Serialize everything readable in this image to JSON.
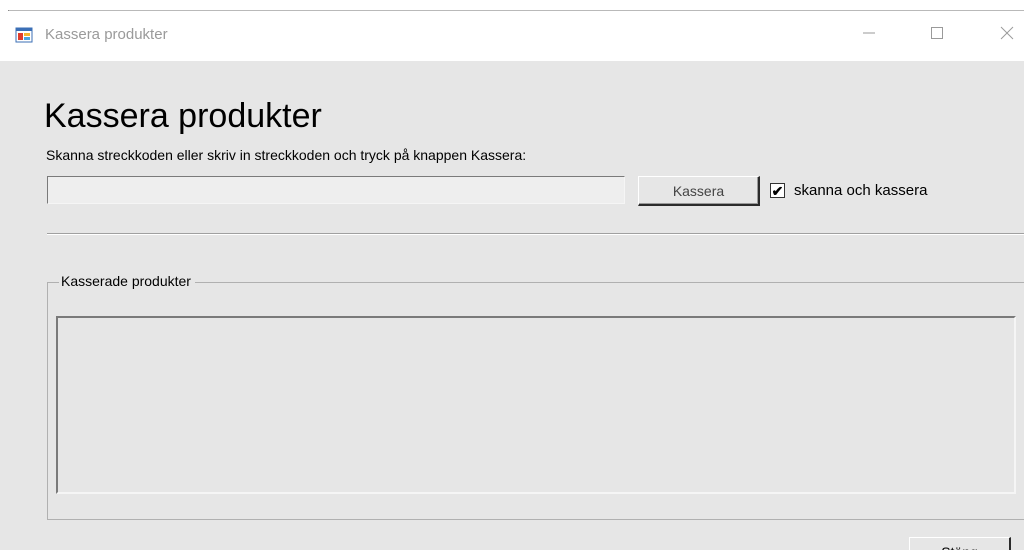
{
  "window": {
    "title": "Kassera produkter"
  },
  "main": {
    "heading": "Kassera produkter",
    "instruction": "Skanna streckkoden eller skriv in streckkoden och tryck på knappen Kassera:",
    "barcode_input": {
      "value": "",
      "placeholder": ""
    },
    "kassera_button": "Kassera",
    "scan_checkbox": {
      "label": "skanna och kassera",
      "checked": true,
      "check_glyph": "✔"
    }
  },
  "group": {
    "label": "Kasserade produkter",
    "items": []
  },
  "footer": {
    "close_button": "Stäng"
  },
  "icons": {
    "app": "app-window-icon",
    "minimize": "minimize-icon",
    "maximize": "maximize-icon",
    "close": "close-icon"
  },
  "colors": {
    "client_background": "#e6e6e6",
    "title_text": "#9a9a9a"
  }
}
